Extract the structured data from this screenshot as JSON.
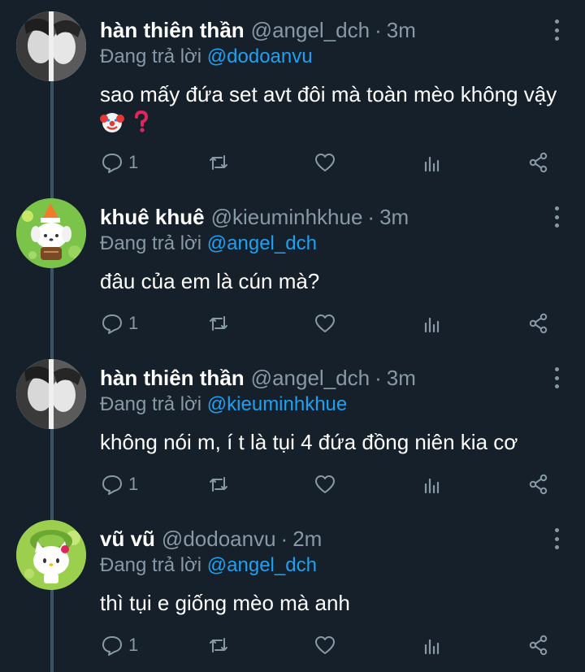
{
  "tweets": [
    {
      "name": "hàn thiên thần",
      "handle": "@angel_dch",
      "separator": "·",
      "time": "3m",
      "reply_prefix": "Đang trả lời",
      "reply_to": "@dodoanvu",
      "text": "sao mấy đứa set avt đôi mà toàn mèo không vậy",
      "emojis": [
        "clown-face",
        "red-question-mark"
      ],
      "reply_count": "1",
      "avatar": "grayscale-photo"
    },
    {
      "name": "khuê khuê",
      "handle": "@kieuminhkhue",
      "separator": "·",
      "time": "3m",
      "reply_prefix": "Đang trả lời",
      "reply_to": "@angel_dch",
      "text": "đâu của em là cún mà?",
      "reply_count": "1",
      "avatar": "cartoon-dog-green"
    },
    {
      "name": "hàn thiên thần",
      "handle": "@angel_dch",
      "separator": "·",
      "time": "3m",
      "reply_prefix": "Đang trả lời",
      "reply_to": "@kieuminhkhue",
      "text": "không nói m, í t là tụi 4 đứa đồng niên kia cơ",
      "reply_count": "1",
      "avatar": "grayscale-photo"
    },
    {
      "name": "vũ vũ",
      "handle": "@dodoanvu",
      "separator": "·",
      "time": "2m",
      "reply_prefix": "Đang trả lời",
      "reply_to": "@angel_dch",
      "text": "thì tụi e giống mèo mà anh",
      "reply_count": "1",
      "avatar": "cartoon-cat-green"
    }
  ],
  "icons": {
    "reply": "comment-icon",
    "retweet": "retweet-icon",
    "like": "heart-icon",
    "views": "analytics-icon",
    "share": "share-icon",
    "more": "more-vertical-icon"
  },
  "colors": {
    "background": "#15202b",
    "text": "#ffffff",
    "muted": "#8899a6",
    "link": "#1da1f2",
    "thread_line": "#3d5466"
  }
}
